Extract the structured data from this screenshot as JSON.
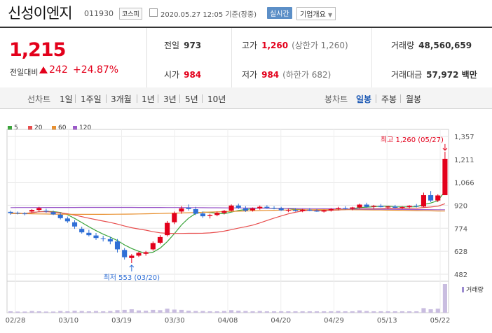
{
  "header": {
    "title": "신성이엔지",
    "code": "011930",
    "market": "코스피",
    "datetime": "2020.05.27 12:05  기준(장중)",
    "live_label": "실시간",
    "corp_label": "기업개요"
  },
  "quote": {
    "price": "1,215",
    "change_label": "전일대비",
    "change_value": "242",
    "change_pct": "+24.87%",
    "prev_close_label": "전일",
    "prev_close": "973",
    "high_label": "고가",
    "high": "1,260",
    "high_sub": "(상한가 1,260)",
    "volume_label": "거래량",
    "volume": "48,560,659",
    "open_label": "시가",
    "open": "984",
    "low_label": "저가",
    "low": "984",
    "low_sub": "(하한가 682)",
    "amount_label": "거래대금",
    "amount": "57,972 백만"
  },
  "tabs": {
    "line_label": "선차트",
    "line_items": [
      "1일",
      "1주일",
      "3개월",
      "1년",
      "3년",
      "5년",
      "10년"
    ],
    "candle_label": "봉차트",
    "candle_items": [
      "일봉",
      "주봉",
      "월봉"
    ],
    "active": "일봉"
  },
  "legend": [
    {
      "label": "5",
      "color": "#3aa33a"
    },
    {
      "label": "20",
      "color": "#e84d4d"
    },
    {
      "label": "60",
      "color": "#e8902f"
    },
    {
      "label": "120",
      "color": "#9b59c9"
    }
  ],
  "colors": {
    "up": "#e3001b",
    "down": "#2f6fd6"
  },
  "chart_data": {
    "type": "candlestick",
    "y_ticks": [
      1357,
      1211,
      1066,
      920,
      774,
      628,
      482
    ],
    "ylim": [
      482,
      1357
    ],
    "x_labels": [
      "02/28",
      "03/10",
      "03/19",
      "03/30",
      "04/08",
      "04/20",
      "04/29",
      "05/13",
      "05/22"
    ],
    "high_annotation": "최고 1,260 (05/27)",
    "low_annotation": "최저 553 (03/20)",
    "volume_label": "거래량",
    "candles": [
      [
        878,
        885,
        860,
        870
      ],
      [
        872,
        880,
        862,
        868
      ],
      [
        868,
        876,
        856,
        864
      ],
      [
        880,
        895,
        872,
        890
      ],
      [
        890,
        910,
        880,
        902
      ],
      [
        885,
        898,
        872,
        880
      ],
      [
        876,
        886,
        858,
        862
      ],
      [
        860,
        870,
        830,
        838
      ],
      [
        836,
        848,
        808,
        818
      ],
      [
        812,
        826,
        770,
        785
      ],
      [
        770,
        784,
        740,
        748
      ],
      [
        745,
        764,
        722,
        730
      ],
      [
        728,
        744,
        700,
        712
      ],
      [
        710,
        726,
        690,
        708
      ],
      [
        705,
        720,
        672,
        690
      ],
      [
        690,
        706,
        620,
        640
      ],
      [
        636,
        648,
        575,
        590
      ],
      [
        585,
        610,
        553,
        600
      ],
      [
        600,
        625,
        592,
        618
      ],
      [
        612,
        630,
        600,
        622
      ],
      [
        640,
        690,
        632,
        680
      ],
      [
        682,
        730,
        672,
        718
      ],
      [
        730,
        820,
        722,
        808
      ],
      [
        812,
        880,
        800,
        870
      ],
      [
        880,
        915,
        866,
        900
      ],
      [
        905,
        925,
        886,
        896
      ],
      [
        895,
        910,
        858,
        866
      ],
      [
        868,
        880,
        840,
        850
      ],
      [
        852,
        866,
        836,
        858
      ],
      [
        858,
        880,
        850,
        872
      ],
      [
        872,
        890,
        862,
        884
      ],
      [
        886,
        925,
        880,
        918
      ],
      [
        918,
        930,
        896,
        904
      ],
      [
        900,
        914,
        878,
        886
      ],
      [
        888,
        906,
        880,
        900
      ],
      [
        900,
        918,
        892,
        910
      ],
      [
        910,
        920,
        898,
        904
      ],
      [
        904,
        914,
        894,
        902
      ],
      [
        900,
        910,
        884,
        888
      ],
      [
        888,
        898,
        876,
        890
      ],
      [
        890,
        900,
        880,
        884
      ],
      [
        884,
        896,
        876,
        892
      ],
      [
        892,
        902,
        882,
        886
      ],
      [
        886,
        896,
        878,
        880
      ],
      [
        880,
        892,
        874,
        888
      ],
      [
        888,
        902,
        880,
        896
      ],
      [
        896,
        910,
        888,
        902
      ],
      [
        902,
        914,
        892,
        898
      ],
      [
        898,
        910,
        888,
        906
      ],
      [
        906,
        930,
        900,
        924
      ],
      [
        924,
        936,
        904,
        910
      ],
      [
        910,
        922,
        898,
        916
      ],
      [
        916,
        928,
        906,
        908
      ],
      [
        906,
        916,
        896,
        912
      ],
      [
        912,
        922,
        900,
        904
      ],
      [
        904,
        914,
        896,
        908
      ],
      [
        908,
        920,
        900,
        916
      ],
      [
        916,
        928,
        906,
        912
      ],
      [
        912,
        1000,
        908,
        984
      ],
      [
        984,
        1010,
        940,
        950
      ],
      [
        950,
        990,
        940,
        982
      ],
      [
        984,
        1260,
        984,
        1215
      ]
    ],
    "volumes": [
      5,
      4,
      4,
      6,
      5,
      4,
      4,
      6,
      5,
      7,
      6,
      5,
      6,
      5,
      6,
      9,
      10,
      12,
      8,
      7,
      10,
      9,
      14,
      11,
      10,
      7,
      6,
      6,
      5,
      5,
      6,
      9,
      7,
      6,
      5,
      6,
      5,
      5,
      5,
      5,
      5,
      5,
      5,
      5,
      5,
      5,
      6,
      5,
      5,
      8,
      6,
      5,
      5,
      5,
      5,
      5,
      5,
      5,
      16,
      12,
      14,
      100
    ]
  }
}
